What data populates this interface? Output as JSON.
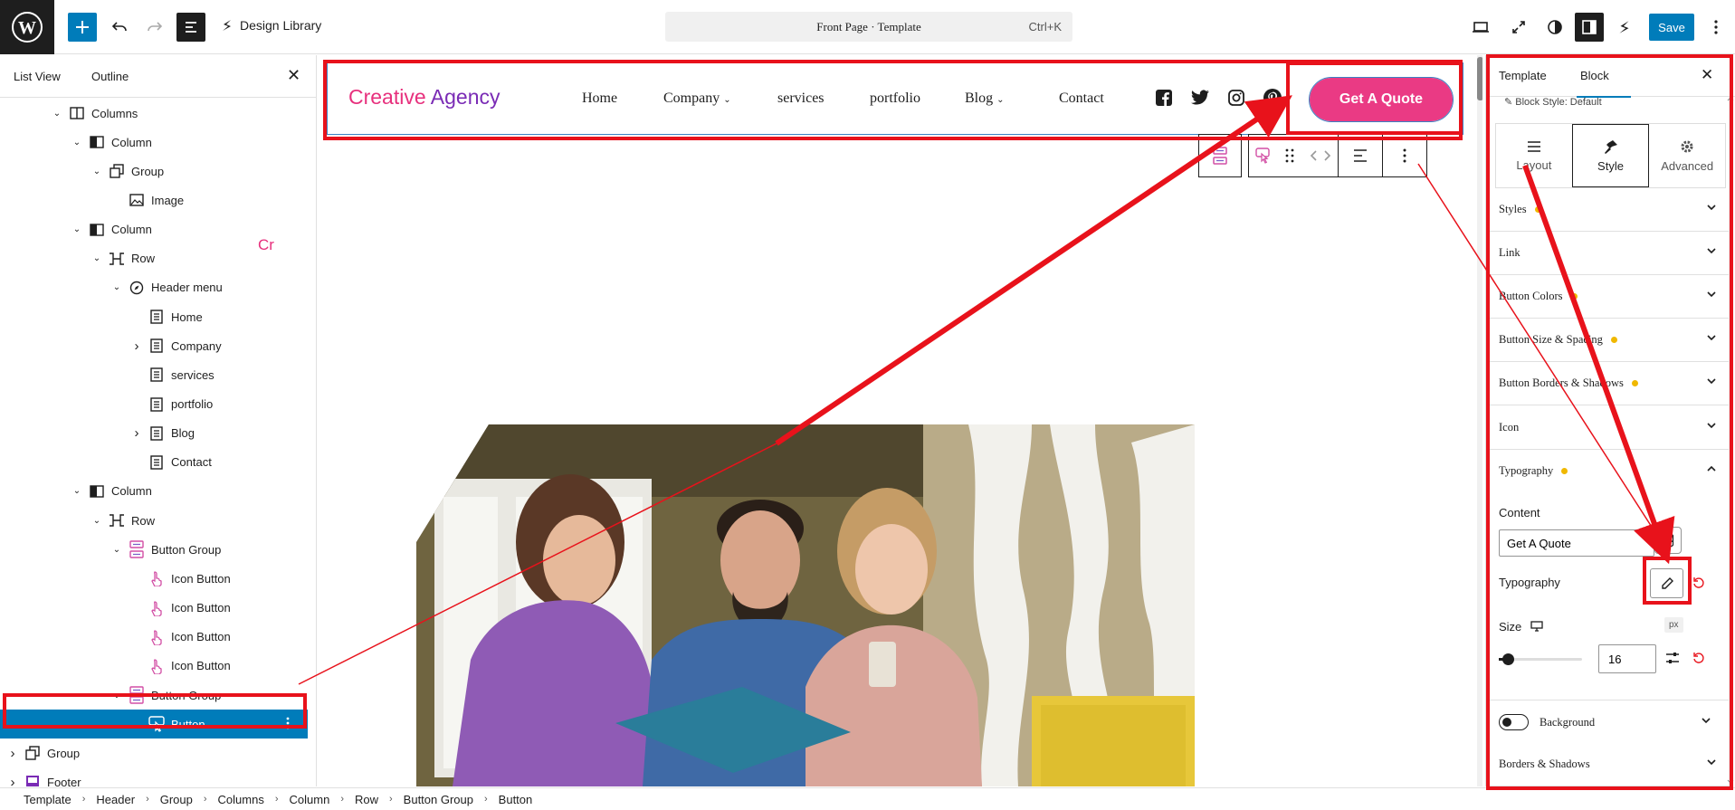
{
  "topbar": {
    "design_library": "Design Library",
    "command_title": "Front Page · Template",
    "command_shortcut": "Ctrl+K",
    "save_label": "Save"
  },
  "left_panel": {
    "tabs": [
      "List View",
      "Outline"
    ],
    "tree": [
      {
        "label": "Columns",
        "depth": 0,
        "expanded": true,
        "icon": "columns-icon"
      },
      {
        "label": "Column",
        "depth": 1,
        "expanded": true,
        "icon": "column-icon"
      },
      {
        "label": "Group",
        "depth": 2,
        "expanded": true,
        "icon": "group-icon"
      },
      {
        "label": "Image",
        "depth": 3,
        "icon": "image-icon"
      },
      {
        "label": "Column",
        "depth": 1,
        "expanded": true,
        "icon": "column-icon"
      },
      {
        "label": "Row",
        "depth": 2,
        "expanded": true,
        "icon": "row-icon"
      },
      {
        "label": "Header menu",
        "depth": 3,
        "expanded": true,
        "icon": "navigation-icon"
      },
      {
        "label": "Home",
        "depth": 4,
        "icon": "page-icon"
      },
      {
        "label": "Company",
        "depth": 4,
        "collapsed": true,
        "icon": "page-icon"
      },
      {
        "label": "services",
        "depth": 4,
        "icon": "page-icon"
      },
      {
        "label": "portfolio",
        "depth": 4,
        "icon": "page-icon"
      },
      {
        "label": "Blog",
        "depth": 4,
        "collapsed": true,
        "icon": "page-icon"
      },
      {
        "label": "Contact",
        "depth": 4,
        "icon": "page-icon"
      },
      {
        "label": "Column",
        "depth": 1,
        "expanded": true,
        "icon": "column-icon"
      },
      {
        "label": "Row",
        "depth": 2,
        "expanded": true,
        "icon": "row-icon"
      },
      {
        "label": "Button Group",
        "depth": 3,
        "expanded": true,
        "icon": "button-group-icon"
      },
      {
        "label": "Icon Button",
        "depth": 4,
        "icon": "icon-button-icon"
      },
      {
        "label": "Icon Button",
        "depth": 4,
        "icon": "icon-button-icon"
      },
      {
        "label": "Icon Button",
        "depth": 4,
        "icon": "icon-button-icon"
      },
      {
        "label": "Icon Button",
        "depth": 4,
        "icon": "icon-button-icon"
      },
      {
        "label": "Button Group",
        "depth": 3,
        "expanded": true,
        "icon": "button-group-icon"
      },
      {
        "label": "Button",
        "depth": 4,
        "selected": true,
        "icon": "button-icon"
      },
      {
        "label": "Group",
        "depth": -1,
        "collapsed": true,
        "icon": "group-icon"
      },
      {
        "label": "Footer",
        "depth": -1,
        "collapsed": true,
        "icon": "footer-icon"
      }
    ],
    "stray_text": "Cr"
  },
  "breadcrumbs": [
    "Template",
    "Header",
    "Group",
    "Columns",
    "Column",
    "Row",
    "Button Group",
    "Button"
  ],
  "canvas": {
    "logo_part1": "Creative",
    "logo_part2": "Agency",
    "nav": [
      "Home",
      "Company",
      "services",
      "portfolio",
      "Blog",
      "Contact"
    ],
    "quote_button": "Get A Quote",
    "social_icons": [
      "facebook-icon",
      "twitter-icon",
      "instagram-icon",
      "pinterest-icon"
    ]
  },
  "right_panel": {
    "tabs": [
      "Template",
      "Block"
    ],
    "active_tab": "Block",
    "block_style": "Block Style: Default",
    "style_tabs": [
      "Layout",
      "Style",
      "Advanced"
    ],
    "active_style_tab": "Style",
    "sections": [
      {
        "label": "Styles",
        "dot": true
      },
      {
        "label": "Link",
        "dot": false
      },
      {
        "label": "Button Colors",
        "dot": true
      },
      {
        "label": "Button Size & Spacing",
        "dot": true
      },
      {
        "label": "Button Borders & Shadows",
        "dot": true
      },
      {
        "label": "Icon",
        "dot": false
      },
      {
        "label": "Typography",
        "dot": true,
        "open": true
      }
    ],
    "content_label": "Content",
    "content_value": "Get A Quote",
    "typography_label": "Typography",
    "size_label": "Size",
    "size_unit": "px",
    "size_value": "16",
    "background_label": "Background",
    "borders_label": "Borders & Shadows"
  },
  "colors": {
    "accent": "#007cba",
    "brand_pink": "#ea3a84",
    "brand_purple": "#7a2bb5",
    "annotation_red": "#e8121b"
  }
}
